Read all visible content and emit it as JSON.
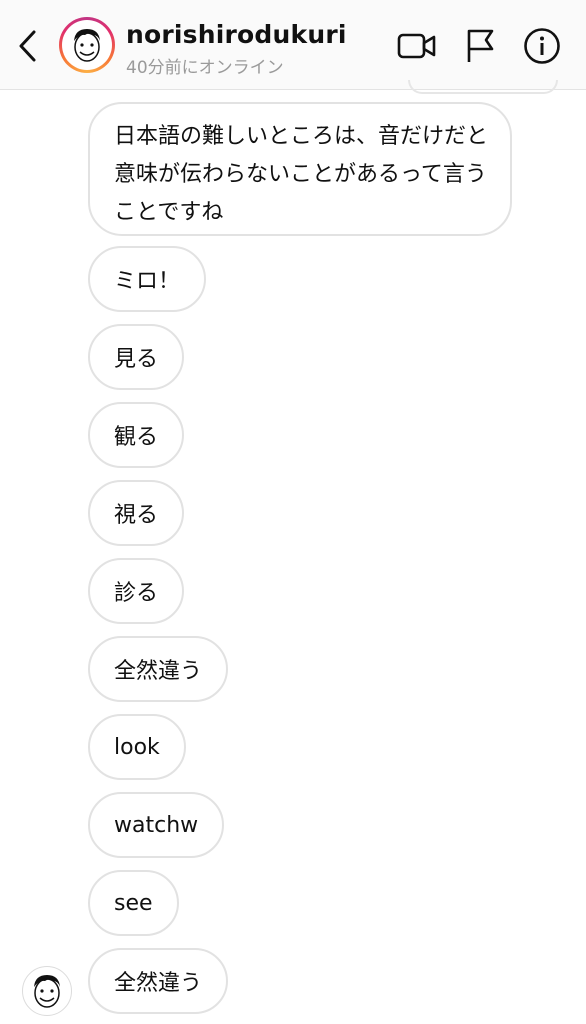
{
  "header": {
    "username": "norishirodukuri",
    "status": "40分前にオンライン",
    "icons": {
      "back": "chevron-left-icon",
      "video": "video-camera-icon",
      "flag": "flag-icon",
      "info": "info-icon"
    }
  },
  "messages": [
    {
      "text": "日本語の難しいところは、音だけだと意味が伝わらないことがあるって言うことですね"
    },
    {
      "text": "ミロ！"
    },
    {
      "text": "見る"
    },
    {
      "text": "観る"
    },
    {
      "text": "視る"
    },
    {
      "text": "診る"
    },
    {
      "text": "全然違う"
    },
    {
      "text": "look"
    },
    {
      "text": "watchw"
    },
    {
      "text": "see"
    },
    {
      "text": "全然違う"
    }
  ]
}
